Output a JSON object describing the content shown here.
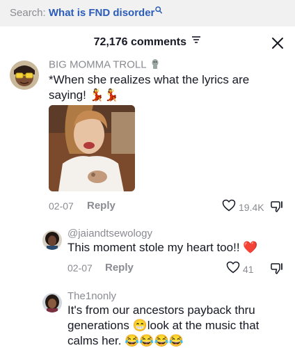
{
  "search": {
    "prefix": "Search:",
    "query": "What is FND disorder"
  },
  "header": {
    "count_label": "72,176 comments"
  },
  "colors": {
    "accent_link": "#2b5db8",
    "muted": "#8a8b91",
    "text": "#161823",
    "heart": "#fe2c55"
  },
  "comments": [
    {
      "username": "BIG MOMMA TROLL",
      "username_badge": "troll-emoji",
      "text_line1": "*When she realizes what the lyrics are",
      "text_line2": "saying! 💃💃",
      "date": "02-07",
      "reply_label": "Reply",
      "likes": "19.4K",
      "has_image": true
    },
    {
      "username": "@jaiandtsewology",
      "text_line1": "This moment stole my heart too!! ❤️",
      "date": "02-07",
      "reply_label": "Reply",
      "likes": "41"
    },
    {
      "username": "The1nonly",
      "text_line1": "It's from our ancestors payback thru",
      "text_line2": "generations 😁look at the music that",
      "text_line3": "calms her. 😂😂😂😂"
    }
  ]
}
